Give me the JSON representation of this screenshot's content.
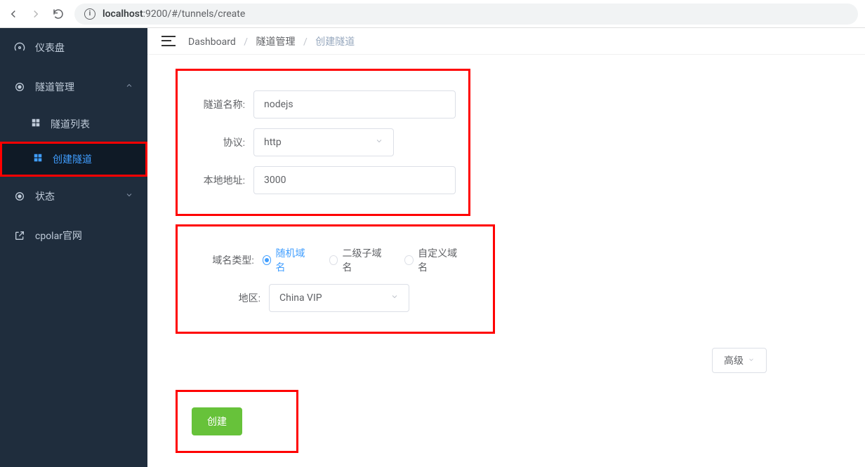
{
  "browser": {
    "host": "localhost",
    "path": ":9200/#/tunnels/create"
  },
  "sidebar": {
    "dashboard": "仪表盘",
    "tunnel_mgmt": "隧道管理",
    "tunnel_list": "隧道列表",
    "tunnel_create": "创建隧道",
    "status": "状态",
    "official": "cpolar官网"
  },
  "breadcrumb": {
    "a": "Dashboard",
    "b": "隧道管理",
    "c": "创建隧道"
  },
  "form": {
    "name_label": "隧道名称:",
    "name_value": "nodejs",
    "proto_label": "协议:",
    "proto_value": "http",
    "addr_label": "本地地址:",
    "addr_value": "3000",
    "domain_type_label": "域名类型:",
    "domain_opts": {
      "random": "随机域名",
      "sub": "二级子域名",
      "custom": "自定义域名"
    },
    "region_label": "地区:",
    "region_value": "China VIP",
    "advanced": "高级",
    "create": "创建"
  }
}
